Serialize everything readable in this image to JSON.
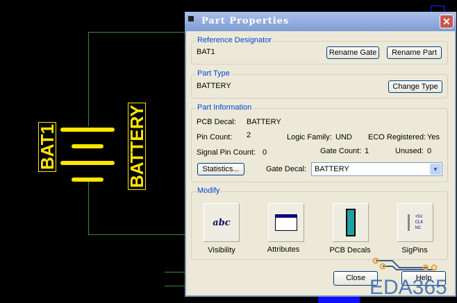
{
  "schematic": {
    "ref": "BAT1",
    "value": "BATTERY"
  },
  "dialog": {
    "title": "Part Properties",
    "close_glyph": "✕",
    "reference": {
      "legend": "Reference Designator",
      "value": "BAT1",
      "rename_gate": "Rename Gate",
      "rename_part": "Rename Part"
    },
    "part_type": {
      "legend": "Part Type",
      "value": "BATTERY",
      "change_type": "Change Type"
    },
    "info": {
      "legend": "Part Information",
      "pcb_decal_label": "PCB Decal:",
      "pcb_decal": "BATTERY",
      "pin_count_label": "Pin Count:",
      "pin_count": "2",
      "logic_family_label": "Logic Family:",
      "logic_family": "UND",
      "eco_label": "ECO Registered:",
      "eco": "Yes",
      "signal_pin_label": "Signal Pin Count:",
      "signal_pin": "0",
      "gate_count_label": "Gate Count:",
      "gate_count": "1",
      "unused_label": "Unused:",
      "unused": "0",
      "statistics": "Statistics...",
      "gate_decal_label": "Gate Decal:",
      "gate_decal": "BATTERY"
    },
    "modify": {
      "legend": "Modify",
      "items": [
        {
          "label": "Visibility",
          "icon": "abc-visibility-icon"
        },
        {
          "label": "Attributes",
          "icon": "attributes-icon"
        },
        {
          "label": "PCB Decals",
          "icon": "pcb-decal-chip-icon"
        },
        {
          "label": "SigPins",
          "icon": "sigpins-icon"
        }
      ],
      "sig_labels": [
        "+5V",
        "CLK",
        "NC"
      ]
    },
    "close": "Close",
    "help": "Help"
  },
  "watermark": "EDA365"
}
